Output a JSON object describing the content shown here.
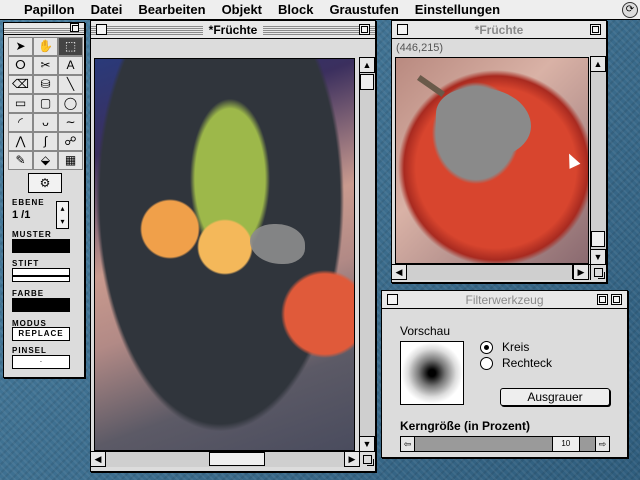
{
  "menubar": {
    "items": [
      "Papillon",
      "Datei",
      "Bearbeiten",
      "Objekt",
      "Block",
      "Graustufen",
      "Einstellungen"
    ],
    "right_icon": "switcher-icon"
  },
  "palette": {
    "tools": [
      {
        "icon": "arrow-icon",
        "glyph": "➤"
      },
      {
        "icon": "hand-icon",
        "glyph": "✋"
      },
      {
        "icon": "marquee-icon",
        "glyph": "⬚"
      },
      {
        "icon": "lasso-icon",
        "glyph": "ⵔ"
      },
      {
        "icon": "scissors-icon",
        "glyph": "✂"
      },
      {
        "icon": "text-icon",
        "glyph": "A"
      },
      {
        "icon": "eraser-icon",
        "glyph": "⌫"
      },
      {
        "icon": "bucket-icon",
        "glyph": "⛁"
      },
      {
        "icon": "line-icon",
        "glyph": "╲"
      },
      {
        "icon": "rectangle-icon",
        "glyph": "▭"
      },
      {
        "icon": "rounded-rect-icon",
        "glyph": "▢"
      },
      {
        "icon": "ellipse-icon",
        "glyph": "◯"
      },
      {
        "icon": "arc-icon",
        "glyph": "◜"
      },
      {
        "icon": "brush-icon",
        "glyph": "ᴗ"
      },
      {
        "icon": "freehand-icon",
        "glyph": "∼"
      },
      {
        "icon": "polygon-icon",
        "glyph": "⋀"
      },
      {
        "icon": "curve-icon",
        "glyph": "∫"
      },
      {
        "icon": "smudge-icon",
        "glyph": "☍"
      },
      {
        "icon": "eyedropper-icon",
        "glyph": "✎"
      },
      {
        "icon": "fill-icon",
        "glyph": "⬙"
      },
      {
        "icon": "gradient-icon",
        "glyph": "▦"
      }
    ],
    "stamp_icon": "stamp-icon",
    "ebene_label": "EBENE",
    "ebene_value": "1 /1",
    "muster_label": "MUSTER",
    "stift_label": "STIFT",
    "farbe_label": "FARBE",
    "modus_label": "MODUS",
    "modus_value": "REPLACE",
    "pinsel_label": "PINSEL"
  },
  "window_main": {
    "title": "*Früchte"
  },
  "window_zoom": {
    "title": "*Früchte",
    "coords": "(446,215)"
  },
  "filter_dialog": {
    "title": "Filterwerkzeug",
    "preview_label": "Vorschau",
    "option_kreis": "Kreis",
    "option_rechteck": "Rechteck",
    "selected_option": "Kreis",
    "button_label": "Ausgrauer",
    "kerngroesse_label": "Kerngröße (in Prozent)",
    "kerngroesse_value": "10",
    "kerngroesse_fraction": 0.1
  }
}
